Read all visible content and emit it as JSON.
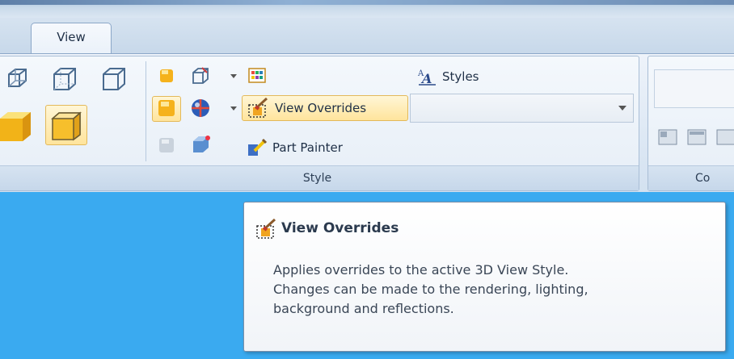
{
  "tabs": [
    {
      "label": "View",
      "active": true
    }
  ],
  "groups": {
    "style": {
      "label": "Style"
    },
    "right": {
      "label": "Co"
    }
  },
  "buttons": {
    "styles": {
      "label": "Styles",
      "icon": "styles-icon"
    },
    "view_overrides": {
      "label": "View Overrides",
      "icon": "view-overrides-icon",
      "highlighted": true
    },
    "part_painter": {
      "label": "Part Painter",
      "icon": "part-painter-icon"
    }
  },
  "dropdown": {
    "value": ""
  },
  "tooltip": {
    "title": "View Overrides",
    "lines": [
      "Applies overrides to the active 3D View Style.",
      "Changes can be made to the rendering, lighting,",
      "background and reflections."
    ]
  },
  "colors": {
    "accent": "#ffe49c",
    "background": "#3aaaf0",
    "ribbon": "#dde8f4"
  }
}
